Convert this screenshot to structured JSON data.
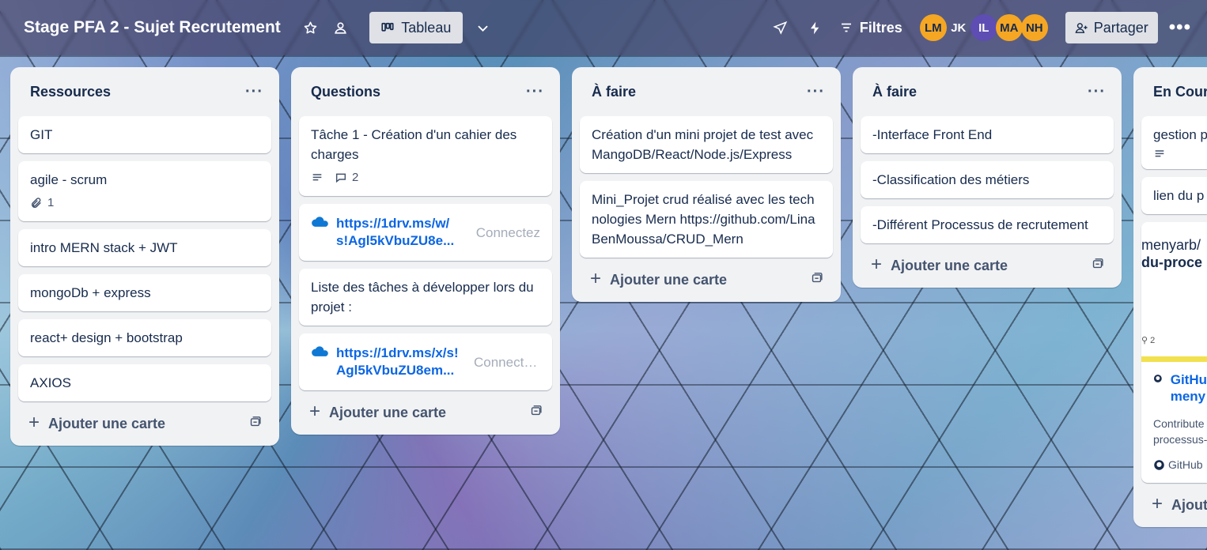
{
  "board": {
    "title": "Stage PFA 2 - Sujet Recrutement",
    "view_label": "Tableau",
    "filters_label": "Filtres",
    "share_label": "Partager",
    "more_label": "•••",
    "members": [
      "LM",
      "JK",
      "IL",
      "MA",
      "NH"
    ]
  },
  "common": {
    "list_menu": "···",
    "add_card": "Ajouter une carte",
    "add_card_short": "Ajout"
  },
  "lists": [
    {
      "title": "Ressources",
      "cards": [
        {
          "text": "GIT"
        },
        {
          "text": "agile - scrum",
          "attachments": "1"
        },
        {
          "text": "intro MERN stack + JWT"
        },
        {
          "text": "mongoDb + express"
        },
        {
          "text": "react+ design + bootstrap"
        },
        {
          "text": "AXIOS"
        }
      ]
    },
    {
      "title": "Questions",
      "cards": [
        {
          "text": "Tâche 1 - Création d'un cahier des charges",
          "comments": "2"
        },
        {
          "link_line1": "https://1drv.ms/w/",
          "link_line2": "s!Agl5kVbuZU8e...",
          "connect": "Connectez"
        },
        {
          "text": "Liste des tâches à développer lors du projet :"
        },
        {
          "link_line1": "https://1drv.ms/x/s!",
          "link_line2": "Agl5kVbuZU8em...",
          "connect": "Connecte..."
        }
      ]
    },
    {
      "title": "À faire",
      "cards": [
        {
          "text": "Création d'un mini projet de test avec MangoDB/React/Node.js/Express"
        },
        {
          "text": "Mini_Projet crud réalisé avec les technologies Mern https://github.com/LinaBenMoussa/CRUD_Mern"
        }
      ]
    },
    {
      "title": "À faire",
      "cards": [
        {
          "text": "-Interface Front End"
        },
        {
          "text": "-Classification des métiers"
        },
        {
          "text": "-Différent Processus de recrutement"
        }
      ]
    },
    {
      "title": "En Cours",
      "cards": [
        {
          "text": "gestion p"
        },
        {
          "text": "lien du p"
        },
        {
          "preview_line1": "menyarb/",
          "preview_line2": "du-proce",
          "preview_contrib": "2",
          "gh_title1": "GitHu",
          "gh_title2": "meny",
          "gh_desc1": "Contribute",
          "gh_desc2": "processus-",
          "gh_source": "GitHub"
        }
      ]
    }
  ]
}
